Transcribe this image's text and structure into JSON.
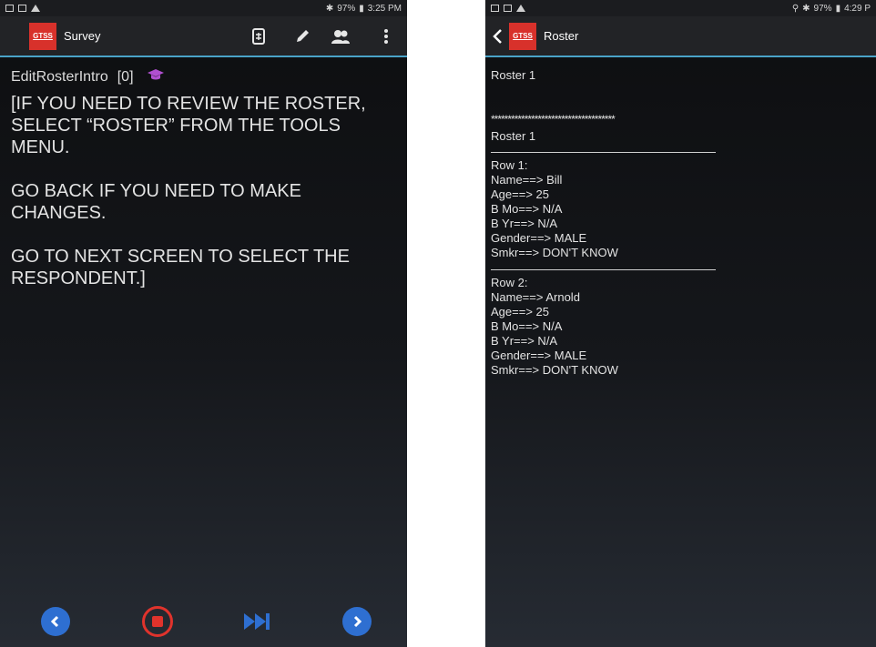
{
  "left": {
    "status": {
      "icons_left": [
        "gallery-icon",
        "cast-icon",
        "warning-icon"
      ],
      "battery": "97%",
      "time": "3:25 PM"
    },
    "appbar": {
      "logo_text": "GTSS",
      "title": "Survey"
    },
    "question": {
      "name": "EditRosterIntro",
      "index": "[0]",
      "paragraphs": [
        "[IF YOU NEED TO REVIEW THE ROSTER, SELECT “ROSTER” FROM THE TOOLS MENU.",
        "GO BACK IF YOU NEED TO MAKE CHANGES.",
        "GO TO NEXT SCREEN TO SELECT THE RESPONDENT.]"
      ]
    },
    "colors": {
      "back": "#2e6fd1",
      "stop": "#e0332c",
      "skip": "#2e6fd1",
      "next": "#2e6fd1"
    }
  },
  "right": {
    "status": {
      "battery": "97%",
      "time": "4:29 P"
    },
    "appbar": {
      "logo_text": "GTSS",
      "title": "Roster"
    },
    "header": "Roster 1",
    "stars": "*************************************",
    "title2": "Roster 1",
    "rows": [
      {
        "label": "Row 1:",
        "name": "Name==> Bill",
        "age": "Age==> 25",
        "bmo": "B Mo==> N/A",
        "byr": "B Yr==> N/A",
        "gender": "Gender==> MALE",
        "smkr": "Smkr==> DON'T KNOW"
      },
      {
        "label": "Row 2:",
        "name": "Name==> Arnold",
        "age": "Age==> 25",
        "bmo": "B Mo==> N/A",
        "byr": "B Yr==> N/A",
        "gender": "Gender==> MALE",
        "smkr": "Smkr==> DON'T KNOW"
      }
    ]
  }
}
